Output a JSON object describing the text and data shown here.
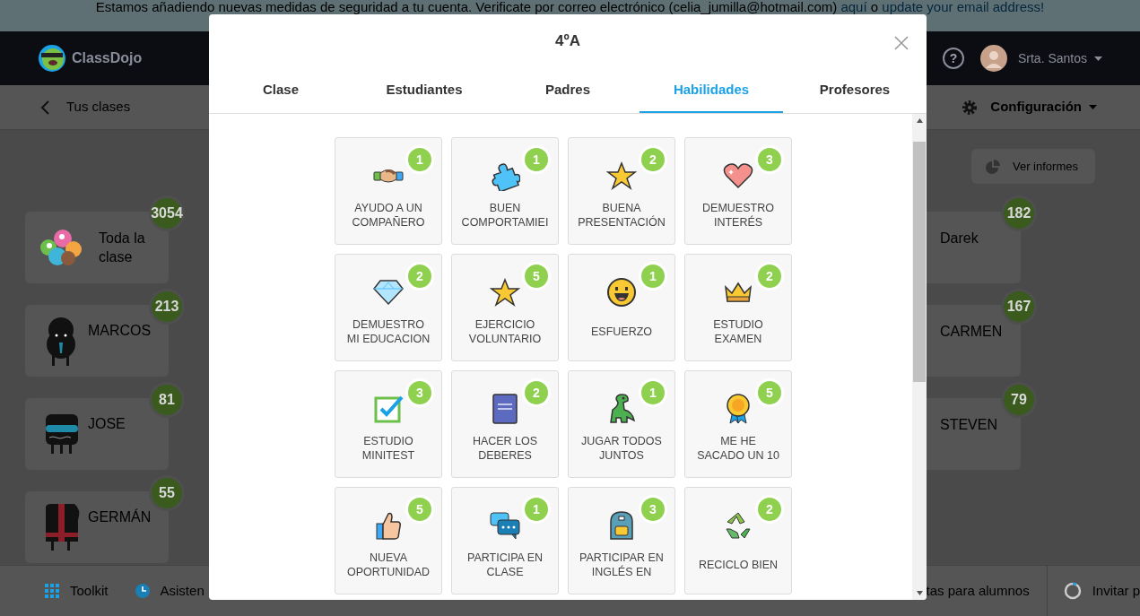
{
  "banner": {
    "text": "Estamos añadiendo nuevas medidas de seguridad a tu cuenta. Verificate por correo electrónico (celia_jumilla@hotmail.com)",
    "link_1": "aquí",
    "joiner": "o",
    "link_2": "update your email address!"
  },
  "header": {
    "logo": "ClassDojo",
    "help": "?",
    "user": "Srta. Santos"
  },
  "subheader": {
    "back": "Tus clases",
    "settings": "Configuración"
  },
  "reports_button": "Ver informes",
  "left_column": [
    {
      "name": "Toda la clase",
      "points": "3054",
      "kind": "group"
    },
    {
      "name": "MARCOS",
      "points": "213",
      "kind": "fluffy"
    },
    {
      "name": "JOSE",
      "points": "81",
      "kind": "box"
    },
    {
      "name": "GERMÁN",
      "points": "55",
      "kind": "striped"
    }
  ],
  "right_column": [
    {
      "name": "Darek",
      "points": "182"
    },
    {
      "name": "CARMEN",
      "points": "167"
    },
    {
      "name": "STEVEN",
      "points": "79"
    }
  ],
  "bottom_bar": {
    "left": [
      "Toolkit",
      "Asisten"
    ],
    "right": [
      "tas para alumnos",
      "Invitar p"
    ]
  },
  "modal": {
    "title": "4ºA",
    "tabs": [
      {
        "label": "Clase",
        "selected": false
      },
      {
        "label": "Estudiantes",
        "selected": false
      },
      {
        "label": "Padres",
        "selected": false
      },
      {
        "label": "Habilidades",
        "selected": true
      },
      {
        "label": "Profesores",
        "selected": false
      }
    ],
    "skills": [
      {
        "label": "AYUDO A UN\nCOMPAÑERO",
        "count": "1"
      },
      {
        "label": "BUEN\nCOMPORTAMIEI",
        "count": "1"
      },
      {
        "label": "BUENA\nPRESENTACIÓN",
        "count": "2"
      },
      {
        "label": "DEMUESTRO\nINTERÉS",
        "count": "3"
      },
      {
        "label": "DEMUESTRO\nMI EDUCACION",
        "count": "2"
      },
      {
        "label": "EJERCICIO\nVOLUNTARIO",
        "count": "5"
      },
      {
        "label": "ESFUERZO",
        "count": "1"
      },
      {
        "label": "ESTUDIO\nEXAMEN",
        "count": "2"
      },
      {
        "label": "ESTUDIO\nMINITEST",
        "count": "3"
      },
      {
        "label": "HACER LOS\nDEBERES",
        "count": "2"
      },
      {
        "label": "JUGAR TODOS\nJUNTOS",
        "count": "1"
      },
      {
        "label": "ME HE\nSACADO UN 10",
        "count": "5"
      },
      {
        "label": "NUEVA\nOPORTUNIDAD",
        "count": "5"
      },
      {
        "label": "PARTICIPA EN\nCLASE",
        "count": "1"
      },
      {
        "label": "PARTICIPAR EN\nINGLÉS EN",
        "count": "3"
      },
      {
        "label": "RECICLO BIEN",
        "count": "2"
      }
    ]
  }
}
